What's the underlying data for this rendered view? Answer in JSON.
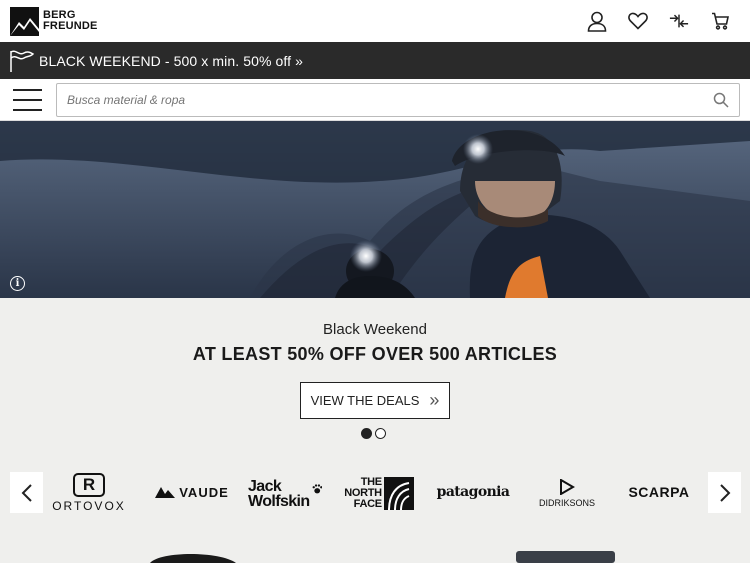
{
  "header": {
    "logo": {
      "line1": "BERG",
      "line2": "FREUNDE"
    },
    "icons": [
      "user-icon",
      "heart-icon",
      "compare-icon",
      "cart-icon"
    ]
  },
  "promo": {
    "text": "BLACK WEEKEND - 500 x min. 50% off »"
  },
  "search": {
    "placeholder": "Busca material & ropa"
  },
  "hero": {
    "info": "i"
  },
  "banner": {
    "subtitle": "Black Weekend",
    "title": "AT LEAST 50% OFF OVER 500 ARTICLES",
    "cta": "VIEW THE DEALS",
    "cta_icon": "»",
    "slide_count": 2,
    "active_slide": 1
  },
  "brands": {
    "items": [
      {
        "name": "ORTOVOX",
        "mark": "R"
      },
      {
        "name": "VAUDE"
      },
      {
        "name": "Jack Wolfskin",
        "line1": "Jack",
        "line2": "Wolfskin"
      },
      {
        "name": "THE NORTH FACE",
        "line1": "THE",
        "line2": "NORTH",
        "line3": "FACE"
      },
      {
        "name": "patagonia"
      },
      {
        "name": "DIDRIKSONS"
      },
      {
        "name": "SCARPA"
      }
    ]
  },
  "colors": {
    "promo_bg": "#2a2a2a",
    "banner_bg": "#efefed",
    "text": "#1a1a1a"
  }
}
